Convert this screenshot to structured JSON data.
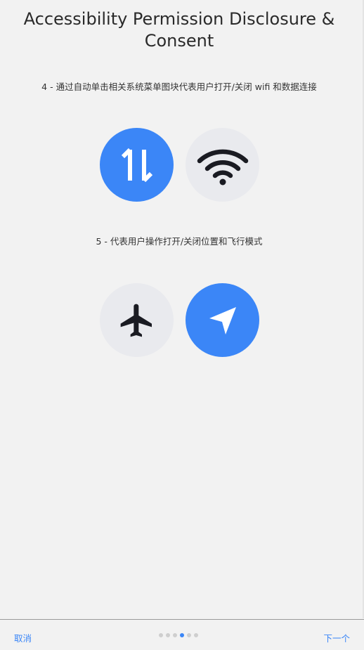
{
  "header": {
    "title": "Accessibility Permission Disclosure & Consent"
  },
  "sections": [
    {
      "description": "4 - 通过自动单击相关系统菜单图块代表用户打开/关闭 wifi 和数据连接",
      "tiles": [
        {
          "icon": "mobile-data-icon",
          "state": "on"
        },
        {
          "icon": "wifi-icon",
          "state": "off"
        }
      ]
    },
    {
      "description": "5 - 代表用户操作打开/关闭位置和飞行模式",
      "tiles": [
        {
          "icon": "airplane-icon",
          "state": "off"
        },
        {
          "icon": "location-icon",
          "state": "on"
        }
      ]
    }
  ],
  "footer": {
    "cancel_label": "取消",
    "next_label": "下一个",
    "page_count": 6,
    "current_page": 4
  },
  "colors": {
    "accent": "#3b86f7",
    "tile_off": "#e9eaee",
    "icon_dark": "#1a1b22",
    "background": "#f2f2f2"
  }
}
